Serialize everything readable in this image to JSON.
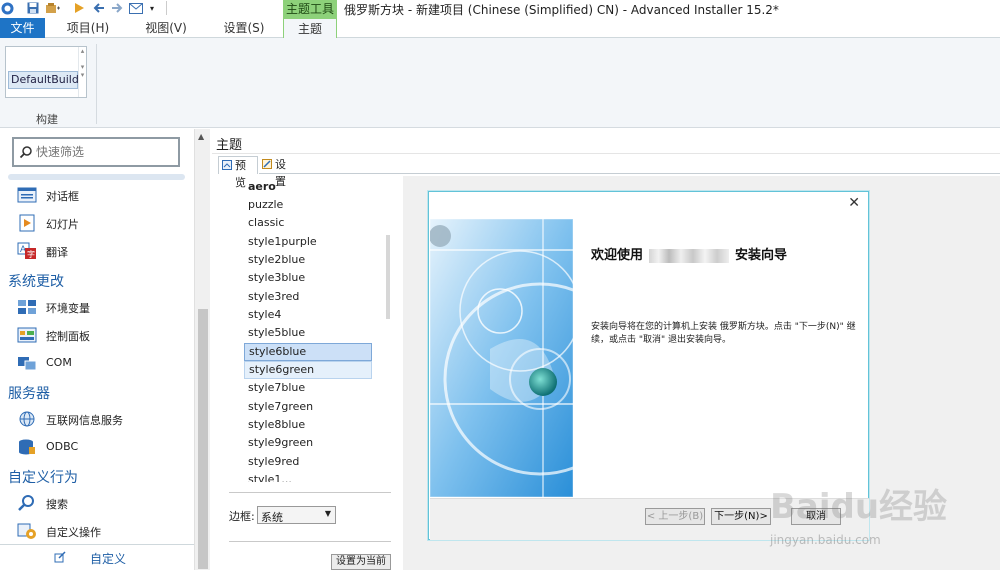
{
  "window": {
    "title": "俄罗斯方块 - 新建项目 (Chinese (Simplified) CN) - Advanced Installer 15.2*",
    "contextual_tab_group": "主题工具"
  },
  "ribbon_tabs": {
    "file": "文件",
    "project": "项目(H)",
    "view": "视图(V)",
    "settings": "设置(S)",
    "theme": "主题"
  },
  "ribbon": {
    "build_value": "DefaultBuild",
    "build_group_label": "构建"
  },
  "left_panel": {
    "search_placeholder": "快速筛选",
    "items": [
      {
        "label": "对话框",
        "icon": "dialog-icon"
      },
      {
        "label": "幻灯片",
        "icon": "slideshow-icon"
      },
      {
        "label": "翻译",
        "icon": "translate-icon"
      }
    ],
    "header_system": "系统更改",
    "system_items": [
      {
        "label": "环境变量",
        "icon": "environment-variables-icon"
      },
      {
        "label": "控制面板",
        "icon": "control-panel-icon"
      },
      {
        "label": "COM",
        "icon": "com-icon"
      }
    ],
    "header_server": "服务器",
    "server_items": [
      {
        "label": "互联网信息服务",
        "icon": "iis-icon"
      },
      {
        "label": "ODBC",
        "icon": "odbc-icon"
      }
    ],
    "header_custom": "自定义行为",
    "custom_items": [
      {
        "label": "搜索",
        "icon": "search-icon"
      },
      {
        "label": "自定义操作",
        "icon": "custom-action-icon"
      }
    ],
    "bottom_label": "自定义"
  },
  "main": {
    "title": "主题",
    "subtab_preview": "预览",
    "subtab_settings": "设置",
    "themes": [
      "aero",
      "puzzle",
      "classic",
      "style1purple",
      "style2blue",
      "style3blue",
      "style3red",
      "style4",
      "style5blue",
      "style6blue",
      "style6green",
      "style7blue",
      "style7green",
      "style8blue",
      "style9green",
      "style9red",
      "style1..."
    ],
    "selected_theme": "style6blue",
    "border_label": "边框:",
    "border_value": "系统",
    "set_current_button": "设置为当前"
  },
  "dialog": {
    "heading_prefix": "欢迎使用",
    "heading_suffix": "安装向导",
    "body": "安装向导将在您的计算机上安装 俄罗斯方块。点击 \"下一步(N)\" 继续，或点击 \"取消\" 退出安装向导。",
    "back_button": "< 上一步(B)",
    "next_button": "下一步(N)>",
    "cancel_button": "取消"
  },
  "watermark": {
    "text": "Baidu经验",
    "url": "jingyan.baidu.com"
  },
  "colors": {
    "accent": "#1e74c6",
    "context_green": "#8dd17a",
    "selection": "#cce0f7",
    "header_blue": "#1f5fa6"
  }
}
